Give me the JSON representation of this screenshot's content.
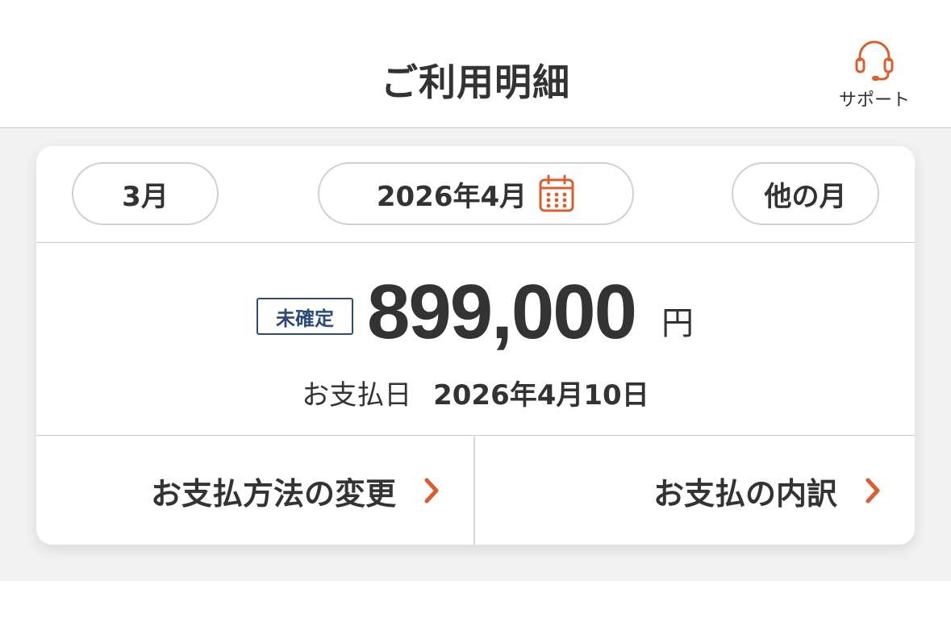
{
  "header": {
    "title": "ご利用明細",
    "support_label": "サポート",
    "support_icon": "headset-icon"
  },
  "months": {
    "prev": "3月",
    "current": "2026年4月",
    "other": "他の月",
    "calendar_icon": "calendar-icon"
  },
  "summary": {
    "status": "未確定",
    "amount": "899,000",
    "unit": "円",
    "due_label": "お支払日",
    "due_date": "2026年4月10日"
  },
  "actions": {
    "change_method": "お支払方法の変更",
    "breakdown": "お支払の内訳",
    "chevron_icon": "chevron-right-icon"
  },
  "colors": {
    "accent": "#d9602e",
    "badge": "#2c4a7c",
    "background": "#f2f2f2"
  }
}
